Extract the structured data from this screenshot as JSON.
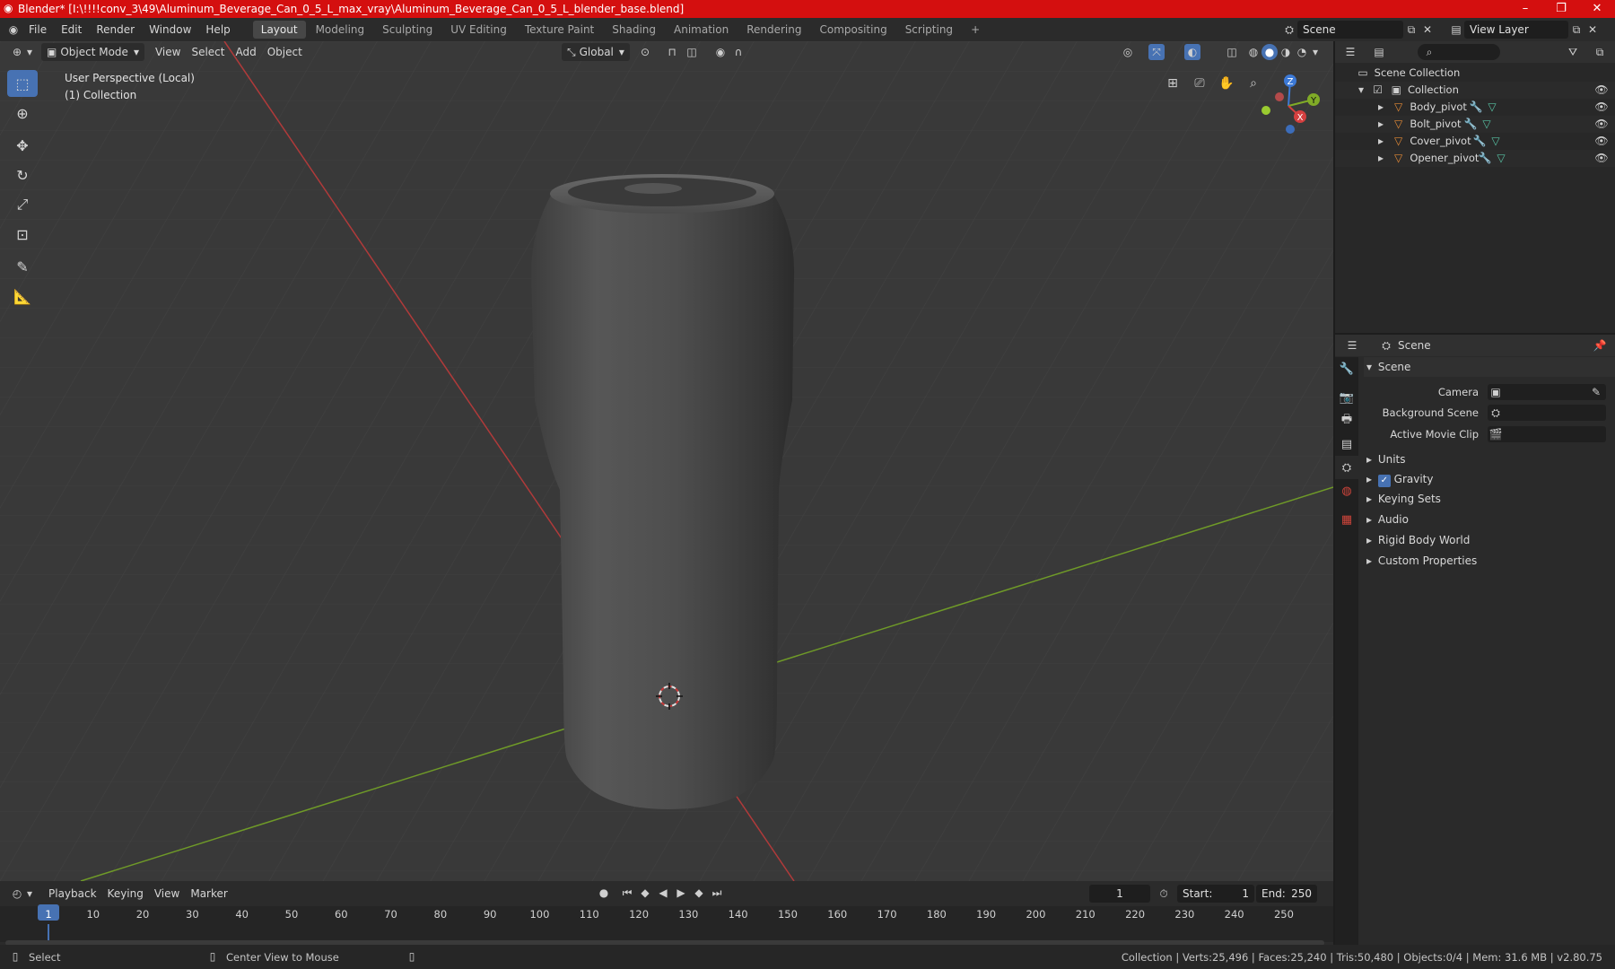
{
  "window": {
    "title": "Blender* [I:\\!!!!conv_3\\49\\Aluminum_Beverage_Can_0_5_L_max_vray\\Aluminum_Beverage_Can_0_5_L_blender_base.blend]",
    "minimize": "–",
    "maximize": "❐",
    "close": "✕"
  },
  "menu": [
    "File",
    "Edit",
    "Render",
    "Window",
    "Help"
  ],
  "workspaces": [
    {
      "label": "Layout",
      "active": true
    },
    {
      "label": "Modeling"
    },
    {
      "label": "Sculpting"
    },
    {
      "label": "UV Editing"
    },
    {
      "label": "Texture Paint"
    },
    {
      "label": "Shading"
    },
    {
      "label": "Animation"
    },
    {
      "label": "Rendering"
    },
    {
      "label": "Compositing"
    },
    {
      "label": "Scripting"
    }
  ],
  "add_workspace": "+",
  "scene_selector": {
    "value": "Scene"
  },
  "view_layer_selector": {
    "value": "View Layer"
  },
  "viewport_header": {
    "mode": "Object Mode",
    "menus": [
      "View",
      "Select",
      "Add",
      "Object"
    ],
    "transform_orientation": "Global"
  },
  "viewport_info": {
    "perspective": "User Perspective (Local)",
    "collection": "(1) Collection"
  },
  "gizmo_axes": {
    "z": "Z",
    "y": "Y",
    "x": "X"
  },
  "outliner": {
    "root": "Scene Collection",
    "collection": "Collection",
    "items": [
      "Body_pivot",
      "Bolt_pivot",
      "Cover_pivot",
      "Opener_pivot"
    ]
  },
  "properties": {
    "header": "Scene",
    "section": "Scene",
    "fields": [
      {
        "label": "Camera"
      },
      {
        "label": "Background Scene"
      },
      {
        "label": "Active Movie Clip"
      }
    ],
    "panels": [
      {
        "label": "Units",
        "checkbox": false
      },
      {
        "label": "Gravity",
        "checkbox": true
      },
      {
        "label": "Keying Sets",
        "checkbox": false
      },
      {
        "label": "Audio",
        "checkbox": false
      },
      {
        "label": "Rigid Body World",
        "checkbox": false
      },
      {
        "label": "Custom Properties",
        "checkbox": false
      }
    ]
  },
  "timeline": {
    "menus": [
      "Playback",
      "Keying",
      "View",
      "Marker"
    ],
    "current_frame": "1",
    "start_label": "Start:",
    "start": "1",
    "end_label": "End:",
    "end": "250",
    "ticks": [
      "1",
      "10",
      "20",
      "30",
      "40",
      "50",
      "60",
      "70",
      "80",
      "90",
      "100",
      "110",
      "120",
      "130",
      "140",
      "150",
      "160",
      "170",
      "180",
      "190",
      "200",
      "210",
      "220",
      "230",
      "240",
      "250"
    ]
  },
  "statusbar": {
    "left": "Select",
    "middle": "Center View to Mouse",
    "right": "Collection | Verts:25,496 | Faces:25,240 | Tris:50,480 | Objects:0/4 | Mem: 31.6 MB | v2.80.75"
  },
  "colors": {
    "title_bar": "#d40f0f",
    "accent": "#4772b3",
    "x_axis": "#c83a3a",
    "y_axis": "#7ea92b",
    "object_icon": "#e38a36"
  }
}
